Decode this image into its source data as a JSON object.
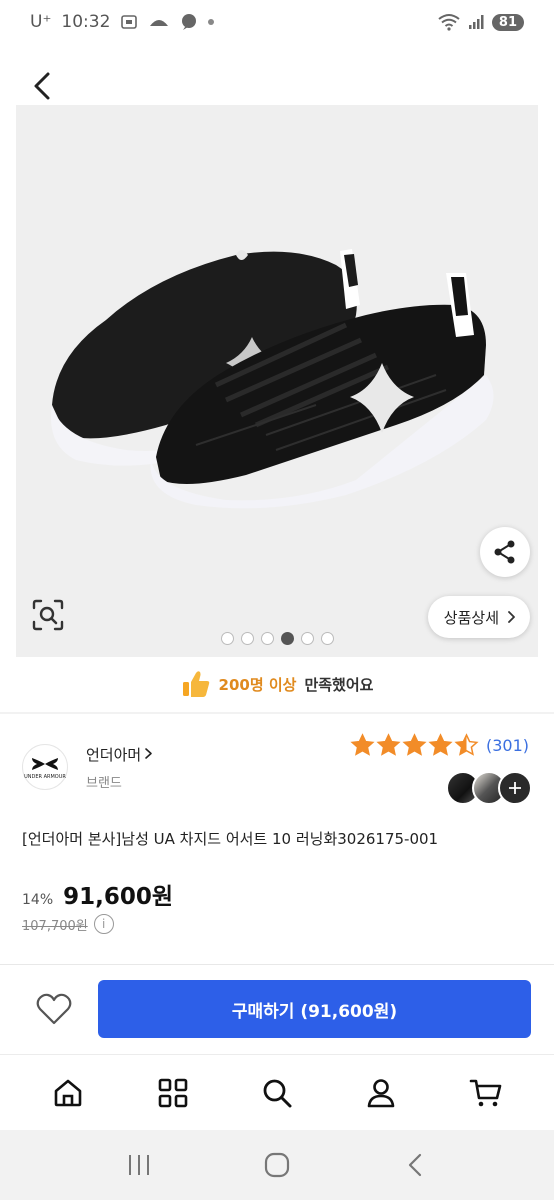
{
  "status_bar": {
    "carrier": "U⁺",
    "time": "10:32",
    "battery": "81"
  },
  "product": {
    "image_pagination": {
      "total": 6,
      "active_index": 3
    },
    "detail_button_label": "상품상세",
    "satisfaction_highlight": "200명 이상",
    "satisfaction_text": "만족했어요",
    "brand_name": "언더아머",
    "brand_sub": "브랜드",
    "brand_logo_text": "UNDER ARMOUR",
    "rating_stars": 4.5,
    "review_count": "(301)",
    "title": "[언더아머 본사]남성 UA 차지드 어서트 10 러닝화3026175-001",
    "discount": "14%",
    "price": "91,600원",
    "original_price": "107,700원"
  },
  "action_bar": {
    "buy_label": "구매하기 (91,600원)"
  },
  "colors": {
    "accent": "#2d5fe8",
    "star": "#f28c28",
    "review_count": "#3b6fe0",
    "satisfaction_highlight": "#e08a1e"
  },
  "tabs": [
    {
      "icon": "home-icon"
    },
    {
      "icon": "category-grid-icon"
    },
    {
      "icon": "search-icon"
    },
    {
      "icon": "user-icon"
    },
    {
      "icon": "cart-icon"
    }
  ]
}
